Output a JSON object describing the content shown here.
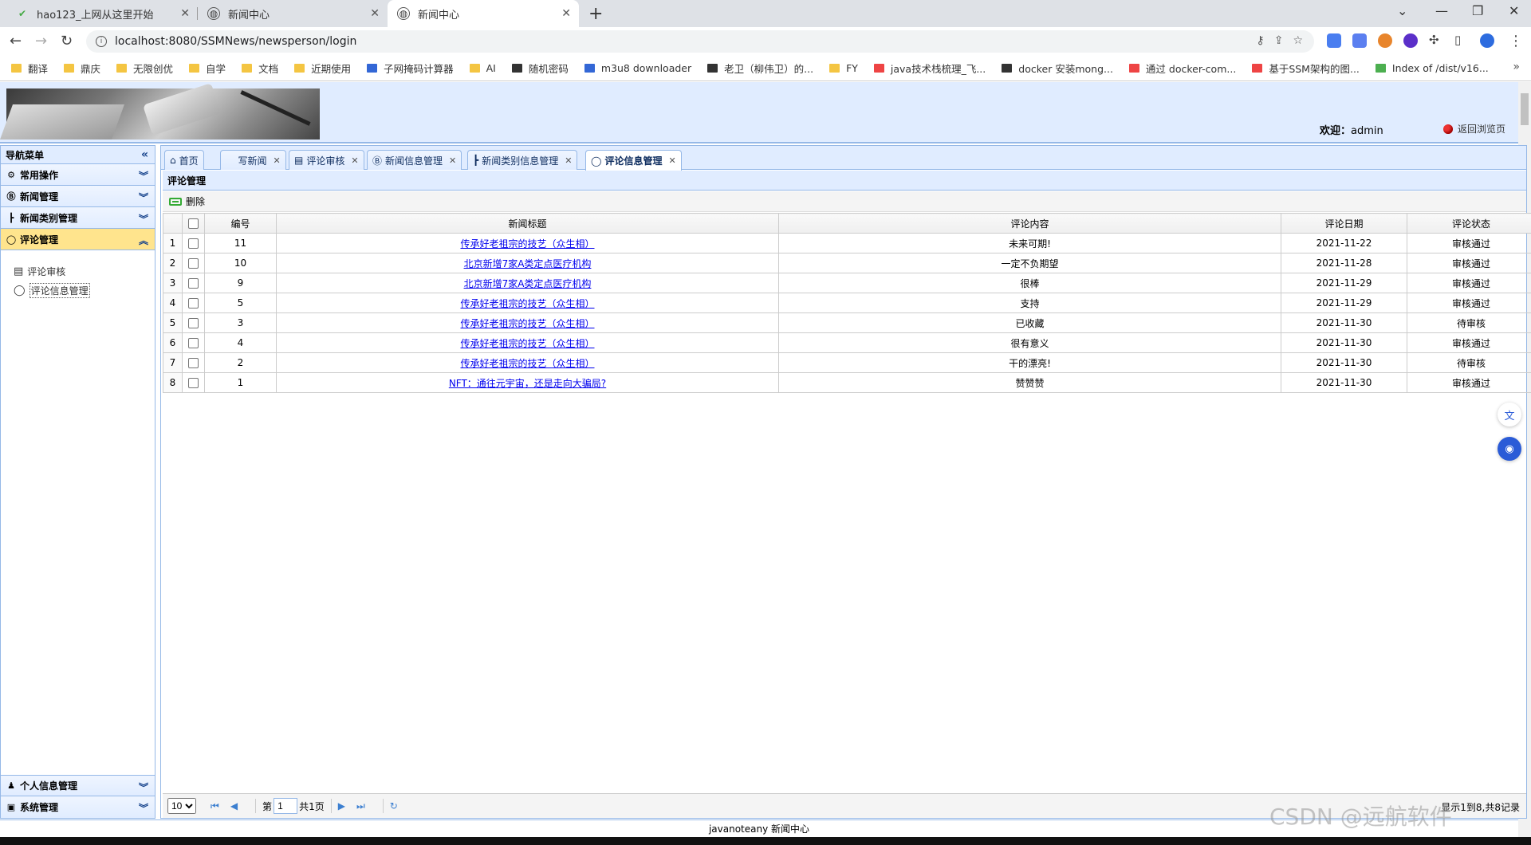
{
  "browser": {
    "tabs": [
      {
        "title": "hao123_上网从这里开始"
      },
      {
        "title": "新闻中心"
      },
      {
        "title": "新闻中心"
      }
    ],
    "url": "localhost:8080/SSMNews/newsperson/login",
    "bookmarks": [
      "翻译",
      "鼎庆",
      "无限创优",
      "自学",
      "文档",
      "近期使用",
      "子网掩码计算器",
      "AI",
      "随机密码",
      "m3u8 downloader",
      "老卫（柳伟卫）的...",
      "FY",
      "java技术栈梳理_飞...",
      "docker 安装mong...",
      "通过 docker-com...",
      "基于SSM架构的图...",
      "Index of /dist/v16..."
    ]
  },
  "header": {
    "welcome_label": "欢迎：",
    "username": "admin",
    "back_link": "返回浏览页"
  },
  "leftnav": {
    "title": "导航菜单",
    "sections": [
      {
        "label": "常用操作"
      },
      {
        "label": "新闻管理"
      },
      {
        "label": "新闻类别管理"
      },
      {
        "label": "评论管理"
      }
    ],
    "sub_items": [
      {
        "label": "评论审核"
      },
      {
        "label": "评论信息管理"
      }
    ],
    "bottom_sections": [
      {
        "label": "个人信息管理"
      },
      {
        "label": "系统管理"
      }
    ]
  },
  "main": {
    "tabs": [
      {
        "label": "首页"
      },
      {
        "label": "写新闻"
      },
      {
        "label": "评论审核"
      },
      {
        "label": "新闻信息管理"
      },
      {
        "label": "新闻类别信息管理"
      },
      {
        "label": "评论信息管理"
      }
    ],
    "panel_title": "评论管理",
    "toolbar": {
      "delete_label": "删除"
    },
    "columns": [
      "编号",
      "新闻标题",
      "评论内容",
      "评论日期",
      "评论状态"
    ],
    "rows": [
      {
        "n": "1",
        "id": "11",
        "title": "传承好老祖宗的技艺（众生相）",
        "content": "未来可期!",
        "date": "2021-11-22",
        "status": "审核通过"
      },
      {
        "n": "2",
        "id": "10",
        "title": "北京新增7家A类定点医疗机构",
        "content": "一定不负期望",
        "date": "2021-11-28",
        "status": "审核通过"
      },
      {
        "n": "3",
        "id": "9",
        "title": "北京新增7家A类定点医疗机构",
        "content": "很棒",
        "date": "2021-11-29",
        "status": "审核通过"
      },
      {
        "n": "4",
        "id": "5",
        "title": "传承好老祖宗的技艺（众生相）",
        "content": "支持",
        "date": "2021-11-29",
        "status": "审核通过"
      },
      {
        "n": "5",
        "id": "3",
        "title": "传承好老祖宗的技艺（众生相）",
        "content": "已收藏",
        "date": "2021-11-30",
        "status": "待审核"
      },
      {
        "n": "6",
        "id": "4",
        "title": "传承好老祖宗的技艺（众生相）",
        "content": "很有意义",
        "date": "2021-11-30",
        "status": "审核通过"
      },
      {
        "n": "7",
        "id": "2",
        "title": "传承好老祖宗的技艺（众生相）",
        "content": "干的漂亮!",
        "date": "2021-11-30",
        "status": "待审核"
      },
      {
        "n": "8",
        "id": "1",
        "title": "NFT：通往元宇宙，还是走向大骗局?",
        "content": "赞赞赞",
        "date": "2021-11-30",
        "status": "审核通过"
      }
    ],
    "pager": {
      "page_size": "10",
      "page_prefix": "第",
      "current_page": "1",
      "total_pages": "共1页",
      "info": "显示1到8,共8记录"
    }
  },
  "footer": {
    "text": "javanoteany 新闻中心"
  },
  "watermark": "CSDN @远航软件"
}
